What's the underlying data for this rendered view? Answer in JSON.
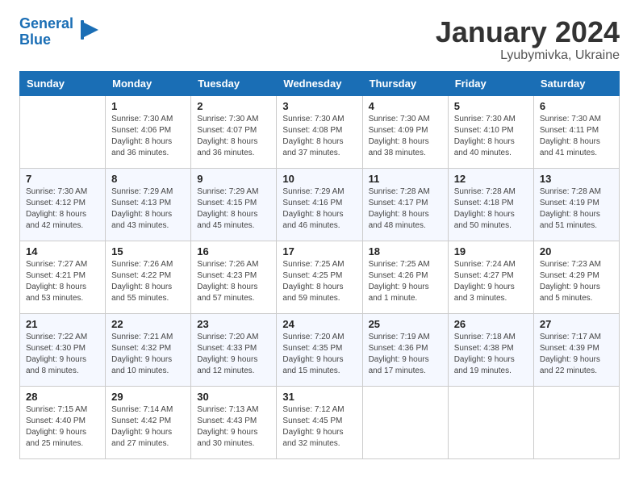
{
  "logo": {
    "line1": "General",
    "line2": "Blue",
    "icon": "▶"
  },
  "title": "January 2024",
  "location": "Lyubymivka, Ukraine",
  "days_of_week": [
    "Sunday",
    "Monday",
    "Tuesday",
    "Wednesday",
    "Thursday",
    "Friday",
    "Saturday"
  ],
  "weeks": [
    [
      {
        "day": "",
        "sunrise": "",
        "sunset": "",
        "daylight": ""
      },
      {
        "day": "1",
        "sunrise": "Sunrise: 7:30 AM",
        "sunset": "Sunset: 4:06 PM",
        "daylight": "Daylight: 8 hours and 36 minutes."
      },
      {
        "day": "2",
        "sunrise": "Sunrise: 7:30 AM",
        "sunset": "Sunset: 4:07 PM",
        "daylight": "Daylight: 8 hours and 36 minutes."
      },
      {
        "day": "3",
        "sunrise": "Sunrise: 7:30 AM",
        "sunset": "Sunset: 4:08 PM",
        "daylight": "Daylight: 8 hours and 37 minutes."
      },
      {
        "day": "4",
        "sunrise": "Sunrise: 7:30 AM",
        "sunset": "Sunset: 4:09 PM",
        "daylight": "Daylight: 8 hours and 38 minutes."
      },
      {
        "day": "5",
        "sunrise": "Sunrise: 7:30 AM",
        "sunset": "Sunset: 4:10 PM",
        "daylight": "Daylight: 8 hours and 40 minutes."
      },
      {
        "day": "6",
        "sunrise": "Sunrise: 7:30 AM",
        "sunset": "Sunset: 4:11 PM",
        "daylight": "Daylight: 8 hours and 41 minutes."
      }
    ],
    [
      {
        "day": "7",
        "sunrise": "Sunrise: 7:30 AM",
        "sunset": "Sunset: 4:12 PM",
        "daylight": "Daylight: 8 hours and 42 minutes."
      },
      {
        "day": "8",
        "sunrise": "Sunrise: 7:29 AM",
        "sunset": "Sunset: 4:13 PM",
        "daylight": "Daylight: 8 hours and 43 minutes."
      },
      {
        "day": "9",
        "sunrise": "Sunrise: 7:29 AM",
        "sunset": "Sunset: 4:15 PM",
        "daylight": "Daylight: 8 hours and 45 minutes."
      },
      {
        "day": "10",
        "sunrise": "Sunrise: 7:29 AM",
        "sunset": "Sunset: 4:16 PM",
        "daylight": "Daylight: 8 hours and 46 minutes."
      },
      {
        "day": "11",
        "sunrise": "Sunrise: 7:28 AM",
        "sunset": "Sunset: 4:17 PM",
        "daylight": "Daylight: 8 hours and 48 minutes."
      },
      {
        "day": "12",
        "sunrise": "Sunrise: 7:28 AM",
        "sunset": "Sunset: 4:18 PM",
        "daylight": "Daylight: 8 hours and 50 minutes."
      },
      {
        "day": "13",
        "sunrise": "Sunrise: 7:28 AM",
        "sunset": "Sunset: 4:19 PM",
        "daylight": "Daylight: 8 hours and 51 minutes."
      }
    ],
    [
      {
        "day": "14",
        "sunrise": "Sunrise: 7:27 AM",
        "sunset": "Sunset: 4:21 PM",
        "daylight": "Daylight: 8 hours and 53 minutes."
      },
      {
        "day": "15",
        "sunrise": "Sunrise: 7:26 AM",
        "sunset": "Sunset: 4:22 PM",
        "daylight": "Daylight: 8 hours and 55 minutes."
      },
      {
        "day": "16",
        "sunrise": "Sunrise: 7:26 AM",
        "sunset": "Sunset: 4:23 PM",
        "daylight": "Daylight: 8 hours and 57 minutes."
      },
      {
        "day": "17",
        "sunrise": "Sunrise: 7:25 AM",
        "sunset": "Sunset: 4:25 PM",
        "daylight": "Daylight: 8 hours and 59 minutes."
      },
      {
        "day": "18",
        "sunrise": "Sunrise: 7:25 AM",
        "sunset": "Sunset: 4:26 PM",
        "daylight": "Daylight: 9 hours and 1 minute."
      },
      {
        "day": "19",
        "sunrise": "Sunrise: 7:24 AM",
        "sunset": "Sunset: 4:27 PM",
        "daylight": "Daylight: 9 hours and 3 minutes."
      },
      {
        "day": "20",
        "sunrise": "Sunrise: 7:23 AM",
        "sunset": "Sunset: 4:29 PM",
        "daylight": "Daylight: 9 hours and 5 minutes."
      }
    ],
    [
      {
        "day": "21",
        "sunrise": "Sunrise: 7:22 AM",
        "sunset": "Sunset: 4:30 PM",
        "daylight": "Daylight: 9 hours and 8 minutes."
      },
      {
        "day": "22",
        "sunrise": "Sunrise: 7:21 AM",
        "sunset": "Sunset: 4:32 PM",
        "daylight": "Daylight: 9 hours and 10 minutes."
      },
      {
        "day": "23",
        "sunrise": "Sunrise: 7:20 AM",
        "sunset": "Sunset: 4:33 PM",
        "daylight": "Daylight: 9 hours and 12 minutes."
      },
      {
        "day": "24",
        "sunrise": "Sunrise: 7:20 AM",
        "sunset": "Sunset: 4:35 PM",
        "daylight": "Daylight: 9 hours and 15 minutes."
      },
      {
        "day": "25",
        "sunrise": "Sunrise: 7:19 AM",
        "sunset": "Sunset: 4:36 PM",
        "daylight": "Daylight: 9 hours and 17 minutes."
      },
      {
        "day": "26",
        "sunrise": "Sunrise: 7:18 AM",
        "sunset": "Sunset: 4:38 PM",
        "daylight": "Daylight: 9 hours and 19 minutes."
      },
      {
        "day": "27",
        "sunrise": "Sunrise: 7:17 AM",
        "sunset": "Sunset: 4:39 PM",
        "daylight": "Daylight: 9 hours and 22 minutes."
      }
    ],
    [
      {
        "day": "28",
        "sunrise": "Sunrise: 7:15 AM",
        "sunset": "Sunset: 4:40 PM",
        "daylight": "Daylight: 9 hours and 25 minutes."
      },
      {
        "day": "29",
        "sunrise": "Sunrise: 7:14 AM",
        "sunset": "Sunset: 4:42 PM",
        "daylight": "Daylight: 9 hours and 27 minutes."
      },
      {
        "day": "30",
        "sunrise": "Sunrise: 7:13 AM",
        "sunset": "Sunset: 4:43 PM",
        "daylight": "Daylight: 9 hours and 30 minutes."
      },
      {
        "day": "31",
        "sunrise": "Sunrise: 7:12 AM",
        "sunset": "Sunset: 4:45 PM",
        "daylight": "Daylight: 9 hours and 32 minutes."
      },
      {
        "day": "",
        "sunrise": "",
        "sunset": "",
        "daylight": ""
      },
      {
        "day": "",
        "sunrise": "",
        "sunset": "",
        "daylight": ""
      },
      {
        "day": "",
        "sunrise": "",
        "sunset": "",
        "daylight": ""
      }
    ]
  ]
}
